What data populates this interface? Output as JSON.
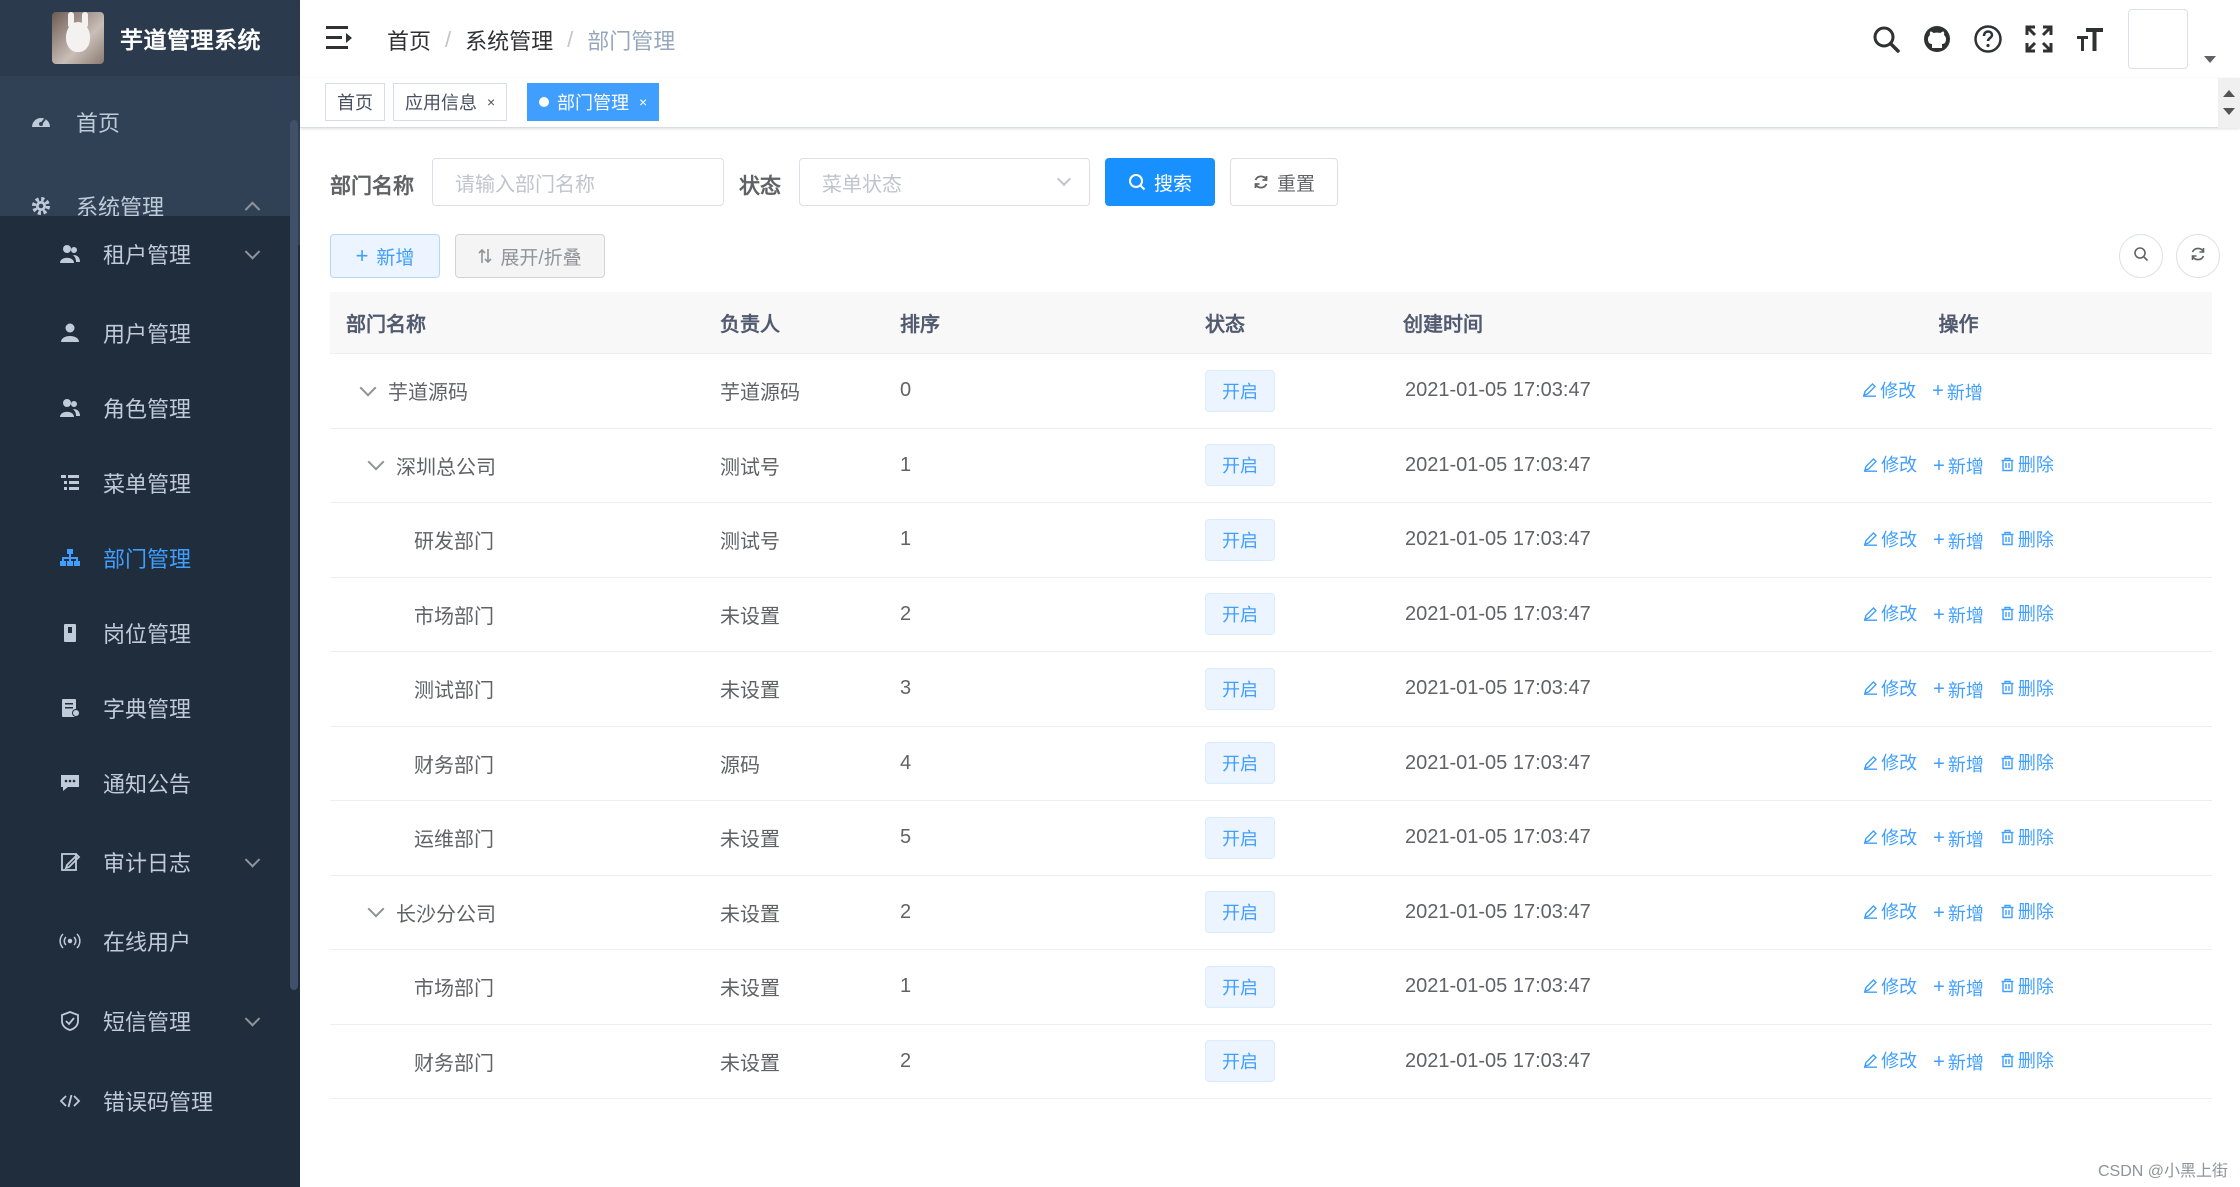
{
  "app": {
    "title": "芋道管理系统"
  },
  "sidebar": {
    "top_items": [
      {
        "label": "首页",
        "icon": "dashboard-icon"
      },
      {
        "label": "系统管理",
        "icon": "gear-icon"
      }
    ],
    "sub_items": [
      {
        "label": "租户管理",
        "icon": "peoples-icon",
        "has_arrow": true
      },
      {
        "label": "用户管理",
        "icon": "user-icon"
      },
      {
        "label": "角色管理",
        "icon": "peoples-icon"
      },
      {
        "label": "菜单管理",
        "icon": "tree-table-icon"
      },
      {
        "label": "部门管理",
        "icon": "tree-icon",
        "active": true
      },
      {
        "label": "岗位管理",
        "icon": "post-icon"
      },
      {
        "label": "字典管理",
        "icon": "dict-icon"
      },
      {
        "label": "通知公告",
        "icon": "message-icon"
      },
      {
        "label": "审计日志",
        "icon": "log-icon",
        "has_arrow": true
      },
      {
        "label": "在线用户",
        "icon": "online-icon"
      },
      {
        "label": "短信管理",
        "icon": "shield-icon",
        "has_arrow": true
      },
      {
        "label": "错误码管理",
        "icon": "code-icon"
      }
    ]
  },
  "breadcrumb": [
    "首页",
    "系统管理",
    "部门管理"
  ],
  "tags": [
    {
      "label": "首页"
    },
    {
      "label": "应用信息",
      "close": "×"
    },
    {
      "label": "部门管理",
      "close": "×",
      "active": true
    }
  ],
  "search": {
    "dept_label": "部门名称",
    "dept_placeholder": "请输入部门名称",
    "status_label": "状态",
    "status_placeholder": "菜单状态",
    "search_button": "搜索",
    "reset_button": "重置"
  },
  "toolbar": {
    "add_button": "新增",
    "expand_button": "展开/折叠"
  },
  "table": {
    "headers": [
      "部门名称",
      "负责人",
      "排序",
      "状态",
      "创建时间",
      "操作"
    ],
    "rows": [
      {
        "name": "芋道源码",
        "leader": "芋道源码",
        "sort": "0",
        "status": "开启",
        "created": "2021-01-05 17:03:47",
        "level": 0,
        "expandable": true,
        "deletable": false
      },
      {
        "name": "深圳总公司",
        "leader": "测试号",
        "sort": "1",
        "status": "开启",
        "created": "2021-01-05 17:03:47",
        "level": 1,
        "expandable": true,
        "deletable": true
      },
      {
        "name": "研发部门",
        "leader": "测试号",
        "sort": "1",
        "status": "开启",
        "created": "2021-01-05 17:03:47",
        "level": 2,
        "expandable": false,
        "deletable": true
      },
      {
        "name": "市场部门",
        "leader": "未设置",
        "sort": "2",
        "status": "开启",
        "created": "2021-01-05 17:03:47",
        "level": 2,
        "expandable": false,
        "deletable": true
      },
      {
        "name": "测试部门",
        "leader": "未设置",
        "sort": "3",
        "status": "开启",
        "created": "2021-01-05 17:03:47",
        "level": 2,
        "expandable": false,
        "deletable": true
      },
      {
        "name": "财务部门",
        "leader": "源码",
        "sort": "4",
        "status": "开启",
        "created": "2021-01-05 17:03:47",
        "level": 2,
        "expandable": false,
        "deletable": true
      },
      {
        "name": "运维部门",
        "leader": "未设置",
        "sort": "5",
        "status": "开启",
        "created": "2021-01-05 17:03:47",
        "level": 2,
        "expandable": false,
        "deletable": true
      },
      {
        "name": "长沙分公司",
        "leader": "未设置",
        "sort": "2",
        "status": "开启",
        "created": "2021-01-05 17:03:47",
        "level": 1,
        "expandable": true,
        "deletable": true
      },
      {
        "name": "市场部门",
        "leader": "未设置",
        "sort": "1",
        "status": "开启",
        "created": "2021-01-05 17:03:47",
        "level": 2,
        "expandable": false,
        "deletable": true
      },
      {
        "name": "财务部门",
        "leader": "未设置",
        "sort": "2",
        "status": "开启",
        "created": "2021-01-05 17:03:47",
        "level": 2,
        "expandable": false,
        "deletable": true
      }
    ],
    "actions": {
      "edit": "修改",
      "add": "新增",
      "delete": "删除"
    }
  },
  "watermark": "CSDN @小黑上街",
  "colors": {
    "primary": "#1890ff",
    "sidebar_bg": "#304156",
    "submenu_bg": "#1f2d3d",
    "active_menu": "#409eff"
  }
}
